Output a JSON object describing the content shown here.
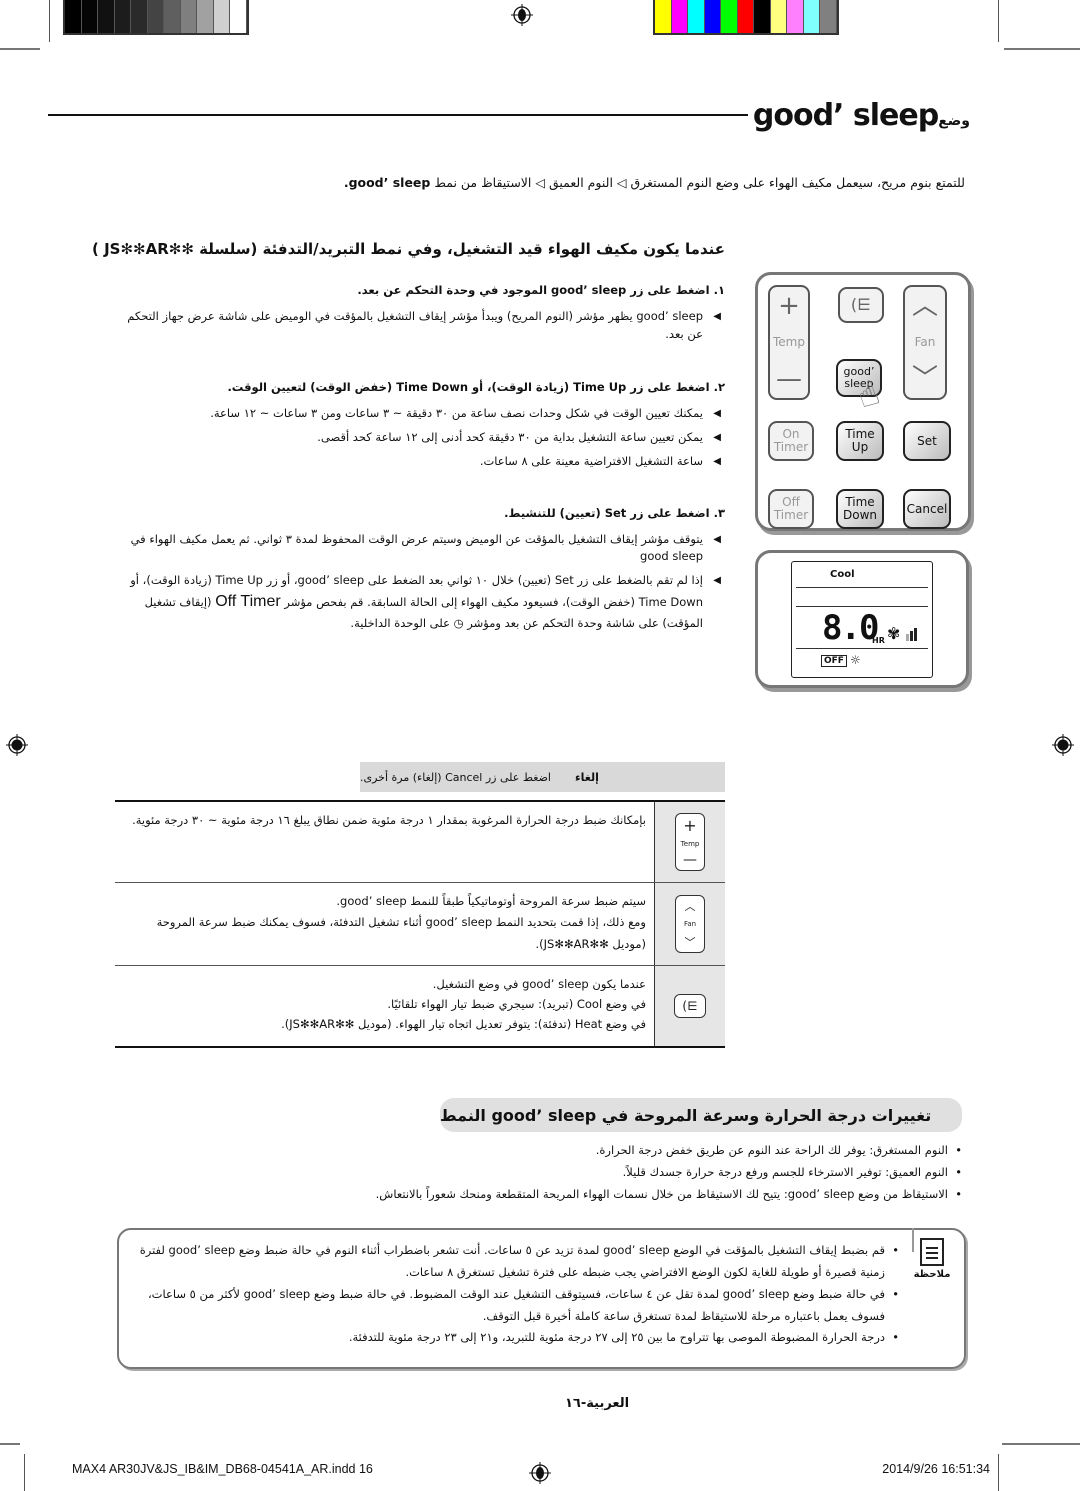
{
  "print_marks": {
    "gray_swatches": [
      "#000000",
      "#050505",
      "#111111",
      "#1c1c1c",
      "#2a2a2a",
      "#444444",
      "#5f5f5f",
      "#7f7f7f",
      "#a1a1a1",
      "#cfcfcf",
      "#ffffff"
    ],
    "color_swatches": [
      "#ffff00",
      "#ff00ff",
      "#00ffff",
      "#0000ff",
      "#00ff00",
      "#ff0000",
      "#000000",
      "#ffff80",
      "#ff80ff",
      "#80ffff",
      "#808080"
    ]
  },
  "header": {
    "title_en": "good’ sleep",
    "title_ar": "وضع"
  },
  "intro": {
    "text_ar": "للتمتع بنوم مريح، سيعمل مكيف الهواء على وضع النوم المستغرق ◁ النوم العميق ◁ الاستيقاظ من نمط",
    "mode_name": "good’ sleep."
  },
  "lead": {
    "text": "عندما يكون مكيف الهواء قيد التشغيل، وفي نمط التبريد/التدفئة (سلسلة ✻✻JS✻✻AR )"
  },
  "steps": [
    {
      "heading": "١. اضغط على زر good’ sleep الموجود في وحدة التحكم عن بعد.",
      "bullets": [
        "good’ sleep يظهر مؤشر (النوم المريح) ويبدأ مؤشر إيقاف التشغيل بالمؤقت في الوميض على شاشة عرض جهاز التحكم عن بعد."
      ]
    },
    {
      "heading": "٢. اضغط على زر Time Up (زيادة الوقت)، أو Time Down (خفض الوقت) لتعيين الوقت.",
      "bullets": [
        "يمكنك تعيين الوقت في شكل وحدات نصف ساعة من ٣٠ دقيقة ~ ٣ ساعات ومن ٣ ساعات ~ ١٢ ساعة.",
        "يمكن تعيين ساعة التشغيل بداية من ٣٠ دقيقة كحد أدنى إلى ١٢ ساعة كحد أقصى.",
        "ساعة التشغيل الافتراضية معينة على ٨ ساعات."
      ]
    },
    {
      "heading": "٣. اضغط على زر Set (تعيين) للتنشيط.",
      "bullets": [
        "يتوقف مؤشر إيقاف التشغيل بالمؤقت عن الوميض وسيتم عرض الوقت المحفوظ لمدة ٣ ثواني. ثم يعمل مكيف الهواء في good sleep",
        "إذا لم تقم بالضغط على زر Set (تعيين) خلال ١٠ ثواني بعد الضغط على good’ sleep، أو زر Time Up (زيادة الوقت)، أو Time Down (خفض الوقت)، فسيعود مكيف الهواء إلى الحالة السابقة. قم بفحص مؤشر"
      ],
      "bullet_tail_en": "Off Timer",
      "bullet_tail_ar": "(إيقاف تشغيل المؤقت) على شاشة وحدة التحكم عن بعد ومؤشر ◷ على الوحدة الداخلية."
    }
  ],
  "remote": {
    "buttons": {
      "temp": "Temp",
      "temp_plus": "+",
      "temp_minus": "—",
      "fan": "Fan",
      "good_sleep": "good’ sleep",
      "on_timer": "On Timer",
      "time_up": "Time Up",
      "set": "Set",
      "off_timer": "Off Timer",
      "time_down": "Time Down",
      "cancel": "Cancel"
    },
    "display": {
      "mode": "Cool",
      "value": "8.0",
      "unit": "HR",
      "off_label": "OFF",
      "fan_level": 3,
      "fan_level_max": 3
    }
  },
  "cancel_bar": {
    "label": "إلغاء",
    "text": "اضغط على زر Cancel (إلغاء) مرة أخرى."
  },
  "table": [
    {
      "icon": "temp-button-icon",
      "icon_label": "Temp",
      "lines": [
        "بإمكانك ضبط درجة الحرارة المرغوبة بمقدار ١ درجة مئوية ضمن نطاق يبلغ ١٦ درجة مئوية ~ ٣٠ درجة مئوية."
      ]
    },
    {
      "icon": "fan-button-icon",
      "icon_label": "Fan",
      "lines": [
        "سيتم ضبط سرعة المروحة أوتوماتيكياً طبقاً للنمط good’ sleep.",
        "ومع ذلك، إذا قمت بتحديد النمط good’ sleep أثناء تشغيل التدفئة، فسوف يمكنك ضبط سرعة المروحة (موديل ✻✻JS✻✻AR)."
      ]
    },
    {
      "icon": "airflow-button-icon",
      "icon_label": "",
      "lines": [
        "عندما يكون good’ sleep في وضع التشغيل.",
        "في وضع Cool (تبريد): سيجري ضبط تيار الهواء تلقائيًا.",
        "في وضع Heat (تدفئة): يتوفر تعديل اتجاه تيار الهواء. (موديل ✻✻JS✻✻AR)."
      ]
    }
  ],
  "section": {
    "title": "تغييرات درجة الحرارة وسرعة المروحة في good’ sleep النمط",
    "items": [
      "النوم المستغرق: يوفر لك الراحة عند النوم عن طريق خفض درجة الحرارة.",
      "النوم العميق: توفير الاسترخاء للجسم ورفع درجة حرارة جسدك قليلاً.",
      "الاستيقاظ من وضع good’ sleep: يتيح لك الاستيقاظ من خلال نسمات الهواء المريحة المتقطعة ومنحك شعوراً بالانتعاش."
    ]
  },
  "note": {
    "label": "ملاحظة",
    "items": [
      "قم بضبط إيقاف التشغيل بالمؤقت في الوضع good’ sleep لمدة تزيد عن ٥ ساعات. أنت تشعر باضطراب أثناء النوم في حالة ضبط وضع good’ sleep لفترة زمنية قصيرة أو طويلة للغاية لكون الوضع الافتراضي يجب ضبطه على فترة تشغيل تستغرق ٨ ساعات.",
      "في حالة ضبط وضع good’ sleep لمدة تقل عن ٤ ساعات، فسيتوقف التشغيل عند الوقت المضبوط. في حالة ضبط وضع good’ sleep لأكثر من ٥ ساعات، فسوف يعمل باعتباره مرحلة للاستيقاظ لمدة تستغرق ساعة كاملة أخيرة قبل التوقف.",
      "درجة الحرارة المضبوطة الموصى بها تتراوح ما بين ٢٥ إلى ٢٧ درجة مئوية للتبريد، و٢١ إلى ٢٣ درجة مئوية للتدفئة."
    ]
  },
  "page_number": "العربية-١٦",
  "footer": {
    "file": "MAX4 AR30JV&JS_IB&IM_DB68-04541A_AR.indd   16",
    "timestamp": "2014/9/26   16:51:34"
  }
}
